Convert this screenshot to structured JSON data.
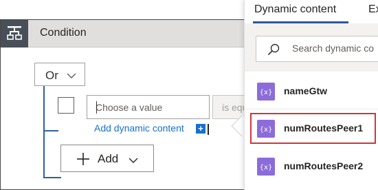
{
  "condition": {
    "title": "Condition",
    "icon": "condition-icon",
    "group_operator": "Or",
    "value_placeholder": "Choose a value",
    "operator_partial": "is equ",
    "add_dynamic_content": "Add dynamic content",
    "add_dynamic_badge": "+",
    "add_button": "Add",
    "colors": {
      "header_bg": "#e1dfdd",
      "icon_bg": "#484f58",
      "tree_line": "#2f5f9f",
      "link": "#1770d1"
    }
  },
  "dynamic_panel": {
    "tabs": [
      {
        "label": "Dynamic content",
        "active": true
      },
      {
        "label": "Ex",
        "active": false
      }
    ],
    "search_placeholder": "Search dynamic co",
    "items": [
      {
        "label": "nameGtw",
        "icon": "expression-icon",
        "selected": false
      },
      {
        "label": "numRoutesPeer1",
        "icon": "expression-icon",
        "selected": true
      },
      {
        "label": "numRoutesPeer2",
        "icon": "expression-icon",
        "selected": false
      }
    ],
    "colors": {
      "item_icon": "#8c6cd9",
      "selection_border": "#d13438",
      "tab_underline": "#2b579a"
    }
  }
}
